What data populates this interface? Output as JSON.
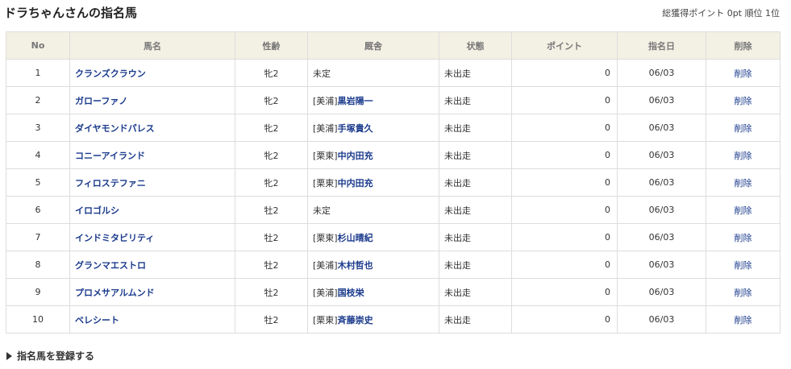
{
  "header": {
    "title": "ドラちゃんさんの指名馬",
    "summary": "総獲得ポイント 0pt 順位 1位"
  },
  "table": {
    "columns": [
      "No",
      "馬名",
      "性齢",
      "厩舎",
      "状態",
      "ポイント",
      "指名日",
      "削除"
    ],
    "rows": [
      {
        "no": "1",
        "name": "クランズクラウン",
        "sexage": "牝2",
        "stable_prefix": "",
        "stable_name": "",
        "stable_plain": "未定",
        "status": "未出走",
        "points": "0",
        "date": "06/03",
        "delete": "削除"
      },
      {
        "no": "2",
        "name": "ガローファノ",
        "sexage": "牝2",
        "stable_prefix": "[美浦]",
        "stable_name": "黒岩陽一",
        "stable_plain": "",
        "status": "未出走",
        "points": "0",
        "date": "06/03",
        "delete": "削除"
      },
      {
        "no": "3",
        "name": "ダイヤモンドパレス",
        "sexage": "牝2",
        "stable_prefix": "[美浦]",
        "stable_name": "手塚貴久",
        "stable_plain": "",
        "status": "未出走",
        "points": "0",
        "date": "06/03",
        "delete": "削除"
      },
      {
        "no": "4",
        "name": "コニーアイランド",
        "sexage": "牝2",
        "stable_prefix": "[栗東]",
        "stable_name": "中内田充",
        "stable_plain": "",
        "status": "未出走",
        "points": "0",
        "date": "06/03",
        "delete": "削除"
      },
      {
        "no": "5",
        "name": "フィロステファニ",
        "sexage": "牝2",
        "stable_prefix": "[栗東]",
        "stable_name": "中内田充",
        "stable_plain": "",
        "status": "未出走",
        "points": "0",
        "date": "06/03",
        "delete": "削除"
      },
      {
        "no": "6",
        "name": "イロゴルシ",
        "sexage": "牡2",
        "stable_prefix": "",
        "stable_name": "",
        "stable_plain": "未定",
        "status": "未出走",
        "points": "0",
        "date": "06/03",
        "delete": "削除"
      },
      {
        "no": "7",
        "name": "インドミタビリティ",
        "sexage": "牡2",
        "stable_prefix": "[栗東]",
        "stable_name": "杉山晴紀",
        "stable_plain": "",
        "status": "未出走",
        "points": "0",
        "date": "06/03",
        "delete": "削除"
      },
      {
        "no": "8",
        "name": "グランマエストロ",
        "sexage": "牡2",
        "stable_prefix": "[美浦]",
        "stable_name": "木村哲也",
        "stable_plain": "",
        "status": "未出走",
        "points": "0",
        "date": "06/03",
        "delete": "削除"
      },
      {
        "no": "9",
        "name": "プロメサアルムンド",
        "sexage": "牡2",
        "stable_prefix": "[美浦]",
        "stable_name": "国枝栄",
        "stable_plain": "",
        "status": "未出走",
        "points": "0",
        "date": "06/03",
        "delete": "削除"
      },
      {
        "no": "10",
        "name": "ベレシート",
        "sexage": "牡2",
        "stable_prefix": "[栗東]",
        "stable_name": "斉藤崇史",
        "stable_plain": "",
        "status": "未出走",
        "points": "0",
        "date": "06/03",
        "delete": "削除"
      }
    ]
  },
  "footer": {
    "register_label": "指名馬を登録する",
    "register_icon": "triangle-right-icon"
  },
  "colors": {
    "header_bg": "#f3f0e4",
    "link": "#1a3a8c",
    "border": "#dddddd"
  }
}
